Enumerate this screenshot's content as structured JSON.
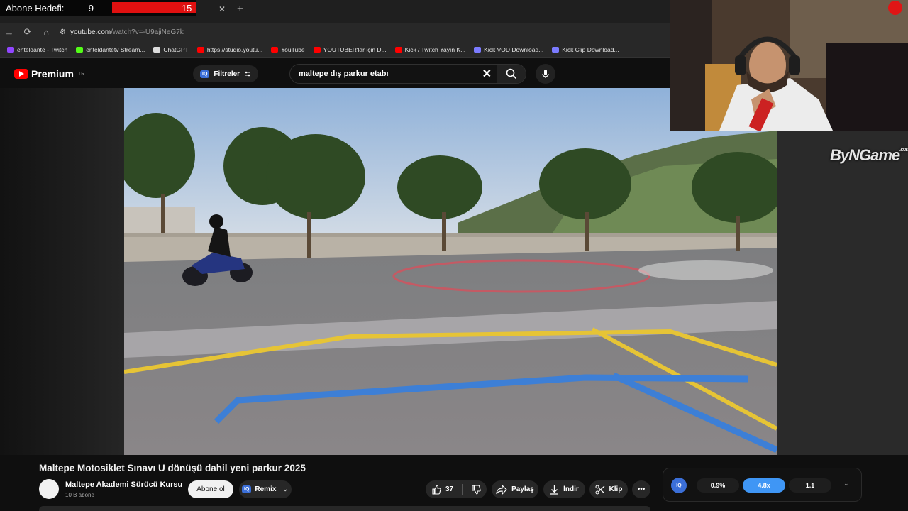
{
  "subscriber_goal": {
    "label": "Abone Hedefi:",
    "current": "9",
    "target": "15"
  },
  "browser": {
    "url_host": "youtube.com",
    "url_path": "/watch?v=-U9ajiNeG7k",
    "bookmarks": [
      {
        "label": "enteldante - Twitch",
        "color": "#9146ff"
      },
      {
        "label": "enteldantetv Stream...",
        "color": "#53fc18"
      },
      {
        "label": "ChatGPT",
        "color": "#dddddd"
      },
      {
        "label": "https://studio.youtu...",
        "color": "#ff0000"
      },
      {
        "label": "YouTube",
        "color": "#ff0000"
      },
      {
        "label": "YOUTUBER'lar için D...",
        "color": "#ff0000"
      },
      {
        "label": "Kick / Twitch Yayın K...",
        "color": "#ff0000"
      },
      {
        "label": "Kick VOD Download...",
        "color": "#7b7bff"
      },
      {
        "label": "Kick Clip Download...",
        "color": "#7b7bff"
      }
    ]
  },
  "youtube": {
    "logo_text": "Premium",
    "region": "TR",
    "filters_label": "Filtreler",
    "iq_label": "IQ",
    "search_value": "maltepe dış parkur etabı"
  },
  "watermark": {
    "text": "ByNGame",
    "suffix": ".com"
  },
  "video": {
    "title": "Maltepe Motosiklet Sınavı U dönüşü dahil yeni parkur 2025",
    "channel": "Maltepe Akademi Sürücü Kursu",
    "subscribers": "10 B abone",
    "subscribe_label": "Abone ol",
    "remix_label": "Remix",
    "likes": "37",
    "share_label": "Paylaş",
    "download_label": "İndir",
    "clip_label": "Klip"
  },
  "iq_panel": {
    "speeds": [
      "0.9%",
      "4.8x",
      "1.1"
    ]
  },
  "colors": {
    "accent": "#ff0000",
    "iq_blue": "#3b6fd8",
    "speed_active": "#3f96f5"
  }
}
